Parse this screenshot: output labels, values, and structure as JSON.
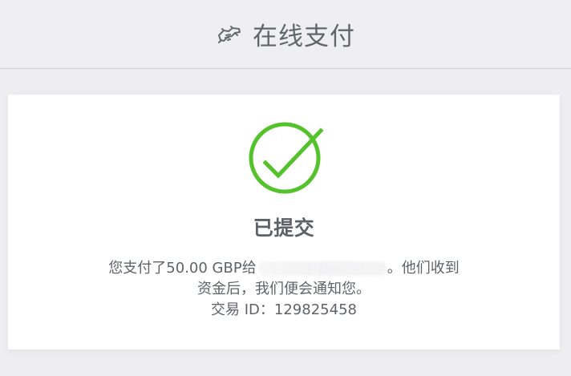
{
  "header": {
    "title": "在线支付",
    "icon": "handshake-icon"
  },
  "status": {
    "icon": "check-circle-icon",
    "title": "已提交"
  },
  "message": {
    "line1_before": "您支付了50.00 GBP给",
    "line1_after": "。他们收到",
    "line2": "资金后，我们便会通知您。",
    "line3": "交易 ID：129825458"
  },
  "colors": {
    "success_green": "#53c22b",
    "text_gray": "#5f6368",
    "background": "#eeeef2"
  }
}
